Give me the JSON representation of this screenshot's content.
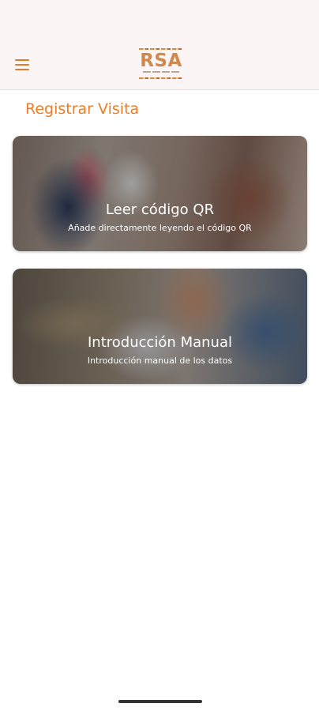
{
  "header": {
    "menu_icon": "hamburger-menu-icon",
    "logo_text": "RSA",
    "accent_color": "#f07b22"
  },
  "page": {
    "title": "Registrar Visita"
  },
  "options": [
    {
      "title": "Leer código QR",
      "subtitle": "Añade directamente leyendo el código QR"
    },
    {
      "title": "Introducción Manual",
      "subtitle": "Introducción manual de los datos"
    }
  ]
}
